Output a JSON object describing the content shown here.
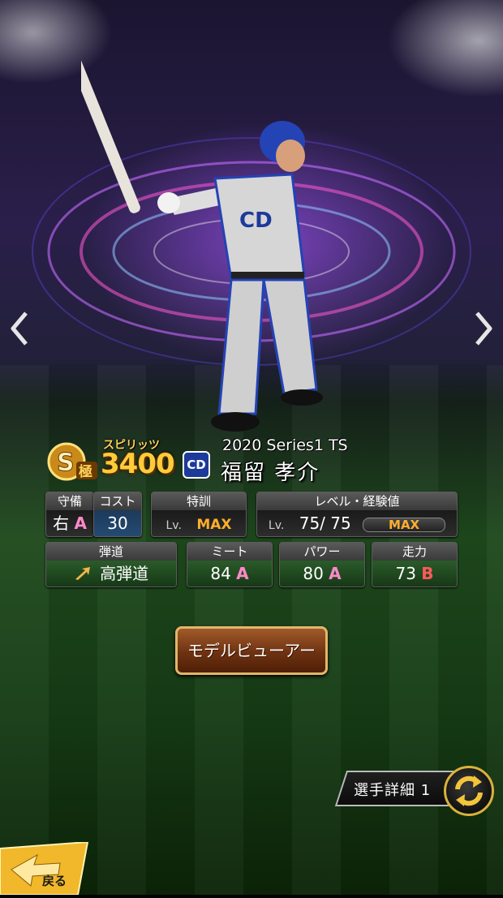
{
  "card": {
    "rank_letter": "S",
    "rank_sub": "極",
    "spirits_label": "スピリッツ",
    "spirits_value": "3400",
    "team_logo": "CD",
    "series": "2020 Series1 TS",
    "player_name": "福留 孝介"
  },
  "stats": {
    "defense": {
      "header": "守備",
      "hand": "右",
      "grade": "A"
    },
    "cost": {
      "header": "コスト",
      "value": "30"
    },
    "training": {
      "header": "特訓",
      "lv_label": "Lv.",
      "value": "MAX"
    },
    "level": {
      "header": "レベル・経験値",
      "lv_label": "Lv.",
      "value": "75/ 75",
      "exp_label": "MAX"
    },
    "trajectory": {
      "header": "弾道",
      "value": "高弾道"
    },
    "meet": {
      "header": "ミート",
      "value": "84",
      "grade": "A"
    },
    "power": {
      "header": "パワー",
      "value": "80",
      "grade": "A"
    },
    "speed": {
      "header": "走力",
      "value": "73",
      "grade": "B"
    }
  },
  "buttons": {
    "model_viewer": "モデルビューアー",
    "player_detail": "選手詳細 1",
    "back": "戻る"
  },
  "icons": {
    "prev": "chevron-left-icon",
    "next": "chevron-right-icon",
    "swap": "swap-arrows-icon",
    "trajectory": "arrow-up-right-icon",
    "back": "back-arrow-icon"
  },
  "colors": {
    "gold": "#ffcc3a",
    "grade_a": "#ff89c9",
    "grade_b": "#ff5a5a",
    "max": "#ffae2e"
  }
}
